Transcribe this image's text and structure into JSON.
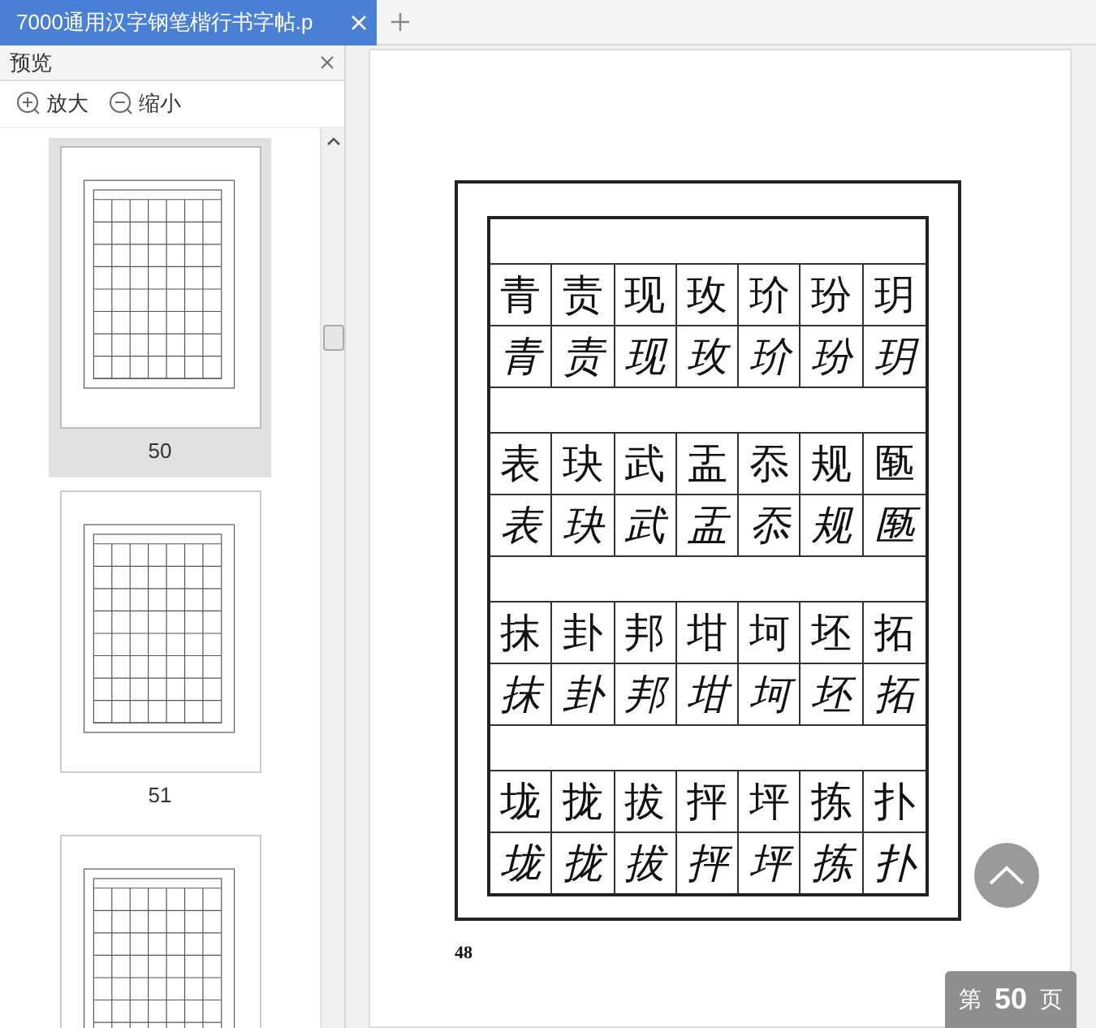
{
  "tabs": [
    {
      "title": "7000通用汉字钢笔楷行书字帖.p",
      "selected": true
    }
  ],
  "sidebar": {
    "title": "预览",
    "zoom_in": "放大",
    "zoom_out": "缩小",
    "thumbnails": [
      {
        "label": "50",
        "selected": true
      },
      {
        "label": "51",
        "selected": false
      },
      {
        "selected": false
      }
    ]
  },
  "document": {
    "groups": [
      {
        "rows": [
          [
            "青",
            "责",
            "现",
            "玫",
            "玠",
            "玢",
            "玥"
          ],
          [
            "青",
            "责",
            "现",
            "玫",
            "玠",
            "玢",
            "玥"
          ]
        ]
      },
      {
        "rows": [
          [
            "表",
            "玦",
            "武",
            "盂",
            "忝",
            "规",
            "匦"
          ],
          [
            "表",
            "玦",
            "武",
            "盂",
            "忝",
            "规",
            "匦"
          ]
        ]
      },
      {
        "rows": [
          [
            "抹",
            "卦",
            "邦",
            "坩",
            "坷",
            "坯",
            "拓"
          ],
          [
            "抹",
            "卦",
            "邦",
            "坩",
            "坷",
            "坯",
            "拓"
          ]
        ]
      },
      {
        "rows": [
          [
            "垅",
            "拢",
            "拔",
            "抨",
            "坪",
            "拣",
            "扑"
          ],
          [
            "垅",
            "拢",
            "拔",
            "抨",
            "坪",
            "拣",
            "扑"
          ]
        ]
      }
    ],
    "page_number": "48"
  },
  "page_indicator": {
    "prefix": "第",
    "page": "50",
    "suffix": "页"
  }
}
